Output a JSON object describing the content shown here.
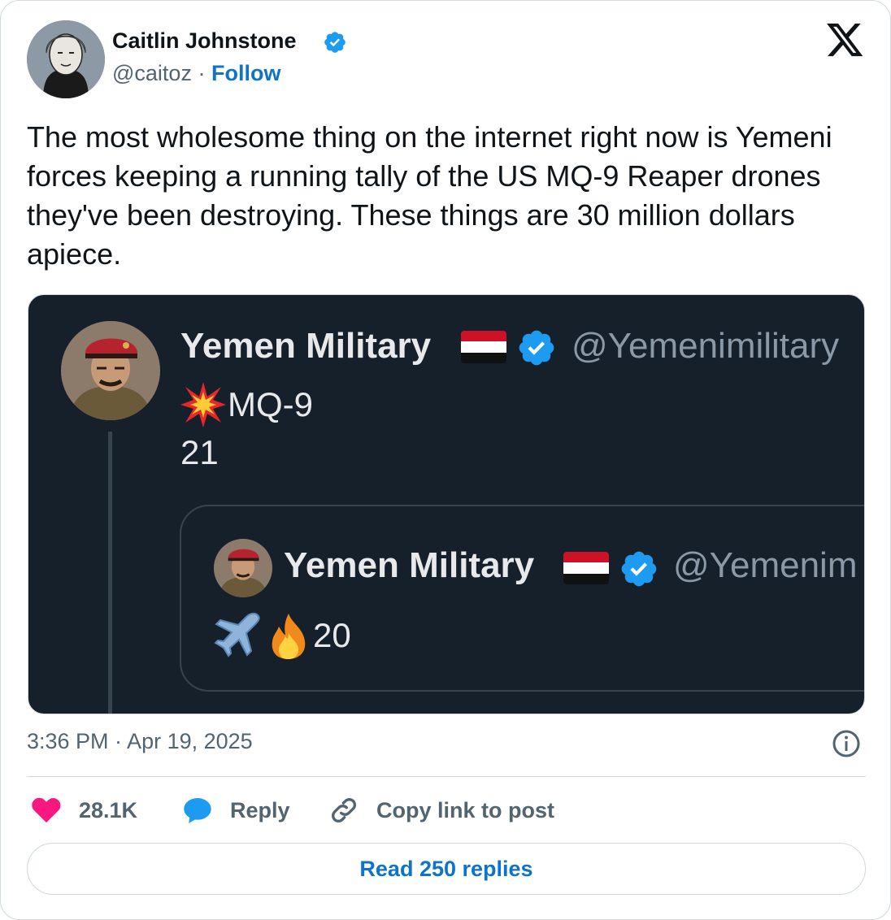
{
  "author": {
    "name": "Caitlin Johnstone",
    "handle": "@caitoz",
    "separator": "·",
    "follow_label": "Follow",
    "verified": true
  },
  "post": {
    "text": "The most wholesome thing on the internet right now is Yemeni forces keeping a running tally of the US MQ-9 Reaper drones they've been destroying. These things are 30 million dollars apiece."
  },
  "media": {
    "main_post": {
      "name": "Yemen Military",
      "handle": "@Yemenimilitary",
      "line1": "MQ-9",
      "line2": "21",
      "emoji": [
        "collision",
        "yemen-flag",
        "verified-badge"
      ]
    },
    "quoted_post": {
      "name": "Yemen Military",
      "handle": "@Yemenim",
      "count": "20",
      "emoji": [
        "airplane",
        "fire",
        "yemen-flag",
        "verified-badge"
      ]
    }
  },
  "footer": {
    "timestamp": "3:36 PM · Apr 19, 2025",
    "like_count": "28.1K",
    "reply_label": "Reply",
    "copy_link_label": "Copy link to post",
    "read_replies_label": "Read 250 replies"
  },
  "colors": {
    "accent": "#0f74c8",
    "like": "#f91880",
    "reply_icon": "#1d9bf0",
    "muted": "#536471",
    "dark_bg": "#15202b"
  }
}
